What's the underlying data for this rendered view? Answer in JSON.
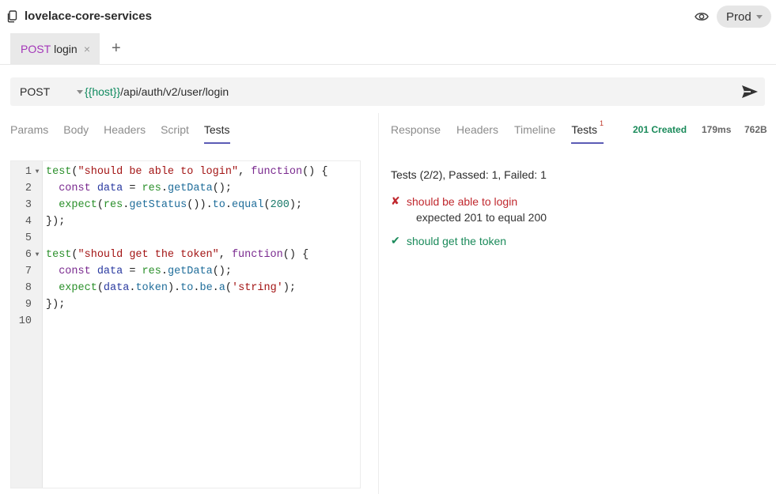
{
  "workspace": {
    "title": "lovelace-core-services",
    "icon": "copy-documents-icon"
  },
  "environment": {
    "visibility_icon": "eye-icon",
    "selected": "Prod"
  },
  "request_tabs": [
    {
      "method": "POST",
      "name": "login",
      "close_label": "×"
    }
  ],
  "add_tab_label": "+",
  "url_bar": {
    "method": "POST",
    "url_variable": "{{host}}",
    "url_path": "/api/auth/v2/user/login",
    "send_icon": "send-icon"
  },
  "request_tabs_nav": [
    {
      "label": "Params",
      "active": false
    },
    {
      "label": "Body",
      "active": false
    },
    {
      "label": "Headers",
      "active": false
    },
    {
      "label": "Script",
      "active": false
    },
    {
      "label": "Tests",
      "active": true
    }
  ],
  "editor": {
    "lines": [
      {
        "n": "1",
        "fold": "▼",
        "tokens": [
          [
            "fn",
            "test"
          ],
          [
            "plain",
            "("
          ],
          [
            "str",
            "\"should be able to login\""
          ],
          [
            "plain",
            ", "
          ],
          [
            "kw",
            "function"
          ],
          [
            "plain",
            "() {"
          ]
        ]
      },
      {
        "n": "2",
        "fold": "",
        "tokens": [
          [
            "plain",
            "  "
          ],
          [
            "kw",
            "const"
          ],
          [
            "plain",
            " "
          ],
          [
            "var",
            "data"
          ],
          [
            "plain",
            " = "
          ],
          [
            "fn",
            "res"
          ],
          [
            "plain",
            "."
          ],
          [
            "call",
            "getData"
          ],
          [
            "plain",
            "();"
          ]
        ]
      },
      {
        "n": "3",
        "fold": "",
        "tokens": [
          [
            "plain",
            "  "
          ],
          [
            "fn",
            "expect"
          ],
          [
            "plain",
            "("
          ],
          [
            "fn",
            "res"
          ],
          [
            "plain",
            "."
          ],
          [
            "call",
            "getStatus"
          ],
          [
            "plain",
            "())."
          ],
          [
            "call",
            "to"
          ],
          [
            "plain",
            "."
          ],
          [
            "call",
            "equal"
          ],
          [
            "plain",
            "("
          ],
          [
            "num",
            "200"
          ],
          [
            "plain",
            ");"
          ]
        ]
      },
      {
        "n": "4",
        "fold": "",
        "tokens": [
          [
            "plain",
            "});"
          ]
        ]
      },
      {
        "n": "5",
        "fold": "",
        "tokens": []
      },
      {
        "n": "6",
        "fold": "▼",
        "tokens": [
          [
            "fn",
            "test"
          ],
          [
            "plain",
            "("
          ],
          [
            "str",
            "\"should get the token\""
          ],
          [
            "plain",
            ", "
          ],
          [
            "kw",
            "function"
          ],
          [
            "plain",
            "() {"
          ]
        ]
      },
      {
        "n": "7",
        "fold": "",
        "tokens": [
          [
            "plain",
            "  "
          ],
          [
            "kw",
            "const"
          ],
          [
            "plain",
            " "
          ],
          [
            "var",
            "data"
          ],
          [
            "plain",
            " = "
          ],
          [
            "fn",
            "res"
          ],
          [
            "plain",
            "."
          ],
          [
            "call",
            "getData"
          ],
          [
            "plain",
            "();"
          ]
        ]
      },
      {
        "n": "8",
        "fold": "",
        "tokens": [
          [
            "plain",
            "  "
          ],
          [
            "fn",
            "expect"
          ],
          [
            "plain",
            "("
          ],
          [
            "var",
            "data"
          ],
          [
            "plain",
            "."
          ],
          [
            "call",
            "token"
          ],
          [
            "plain",
            ")."
          ],
          [
            "call",
            "to"
          ],
          [
            "plain",
            "."
          ],
          [
            "call",
            "be"
          ],
          [
            "plain",
            "."
          ],
          [
            "call",
            "a"
          ],
          [
            "plain",
            "("
          ],
          [
            "str",
            "'string'"
          ],
          [
            "plain",
            ");"
          ]
        ]
      },
      {
        "n": "9",
        "fold": "",
        "tokens": [
          [
            "plain",
            "});"
          ]
        ]
      },
      {
        "n": "10",
        "fold": "",
        "tokens": []
      }
    ]
  },
  "response_tabs_nav": [
    {
      "label": "Response",
      "active": false
    },
    {
      "label": "Headers",
      "active": false
    },
    {
      "label": "Timeline",
      "active": false
    },
    {
      "label": "Tests",
      "active": true,
      "badge": "1"
    }
  ],
  "response_meta": {
    "status": "201 Created",
    "time": "179ms",
    "size": "762B",
    "status_color": "#1a8a5a"
  },
  "test_results": {
    "summary": "Tests (2/2), Passed: 1, Failed: 1",
    "items": [
      {
        "status": "failed",
        "mark": "✘",
        "name": "should be able to login",
        "message": "expected 201 to equal 200"
      },
      {
        "status": "passed",
        "mark": "✔",
        "name": "should get the token"
      }
    ]
  },
  "colors": {
    "accent": "#5b5bb5",
    "method_post": "#a335b8",
    "variable": "#0f8a5f",
    "fail": "#c0282e",
    "pass": "#1a8a5a"
  }
}
